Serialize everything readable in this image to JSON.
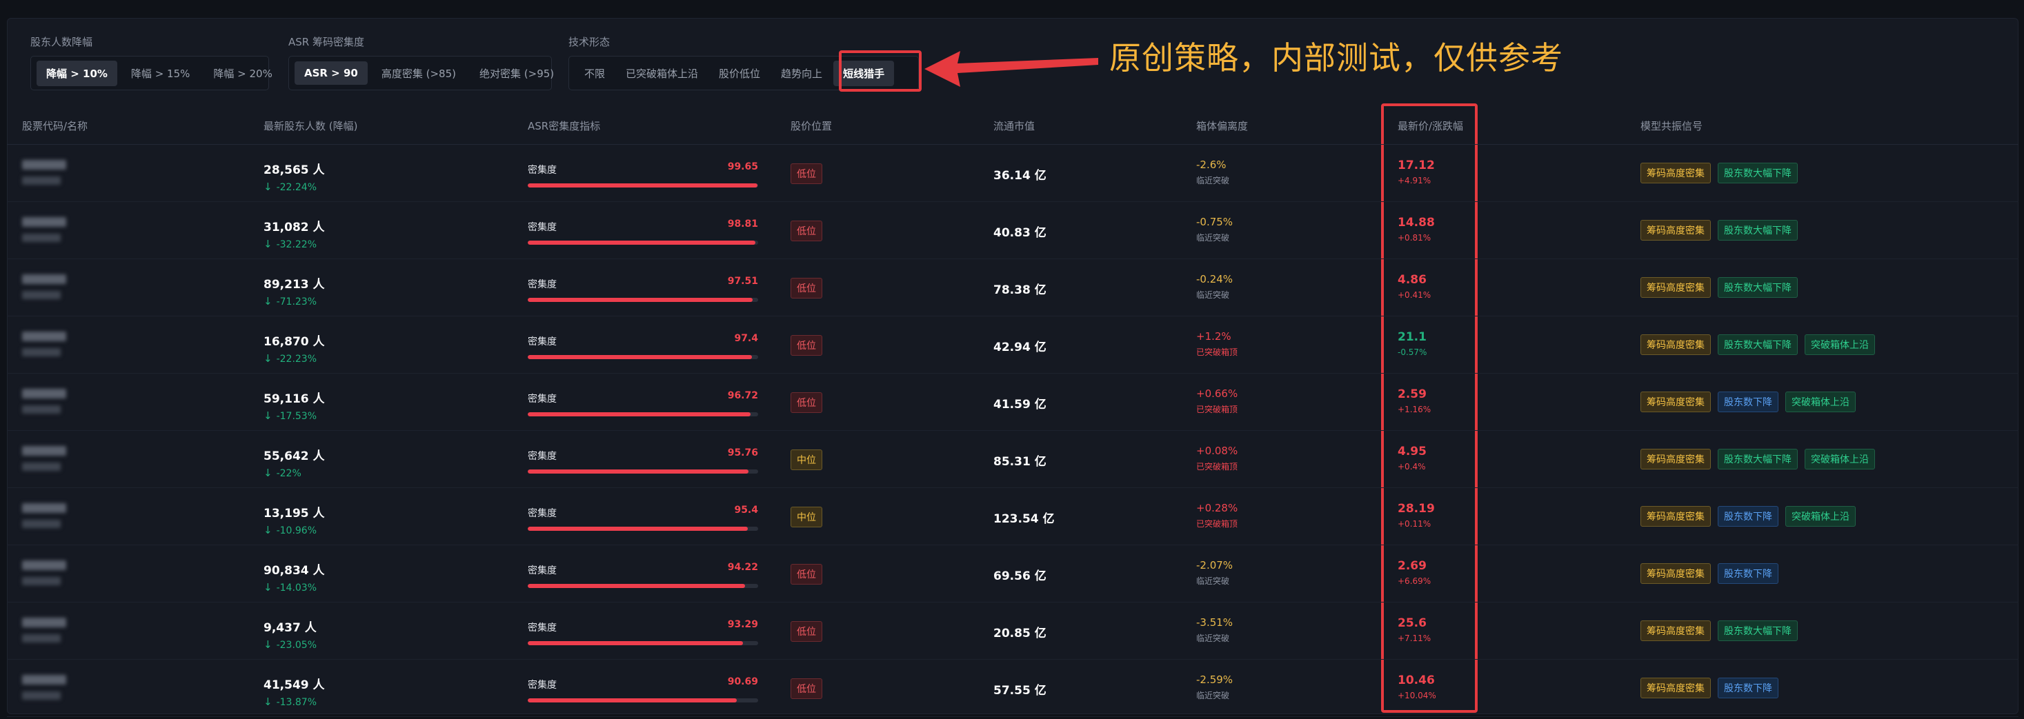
{
  "filters": {
    "holders": {
      "title": "股东人数降幅",
      "options": [
        "降幅 > 10%",
        "降幅 > 15%",
        "降幅 > 20%"
      ]
    },
    "asr": {
      "title": "ASR 筹码密集度",
      "options": [
        "ASR > 90",
        "高度密集 (>85)",
        "绝对密集 (>95)"
      ]
    },
    "tech": {
      "title": "技术形态",
      "options": [
        "不限",
        "已突破箱体上沿",
        "股价低位",
        "趋势向上",
        "短线猎手"
      ]
    }
  },
  "annotation": "原创策略，内部测试，仅供参考",
  "colors": {
    "accent_red": "#f1454f",
    "accent_green": "#22b07d",
    "annotation": "#f6b43a",
    "highlight": "#e63a3f"
  },
  "table": {
    "headers": {
      "code": "股票代码/名称",
      "holders": "最新股东人数 (降幅)",
      "asr": "ASR密集度指标",
      "position": "股价位置",
      "cap": "流通市值",
      "box": "箱体偏离度",
      "price": "最新价/涨跌幅",
      "signals": "模型共振信号"
    },
    "asr_label": "密集度",
    "rows": [
      {
        "holders": "28,565 人",
        "holders_chg": "-22.24%",
        "asr": "99.65",
        "asr_pct": 0.9965,
        "pos": "低位",
        "pos_type": "low",
        "cap": "36.14 亿",
        "box": "-2.6%",
        "box_sub": "临近突破",
        "box_type": "neg",
        "price": "17.12",
        "chg": "+4.91%",
        "dir": "up",
        "tags": [
          "筹码高度密集",
          "股东数大幅下降"
        ],
        "tag_types": [
          "y",
          "g"
        ]
      },
      {
        "holders": "31,082 人",
        "holders_chg": "-32.22%",
        "asr": "98.81",
        "asr_pct": 0.9881,
        "pos": "低位",
        "pos_type": "low",
        "cap": "40.83 亿",
        "box": "-0.75%",
        "box_sub": "临近突破",
        "box_type": "neg",
        "price": "14.88",
        "chg": "+0.81%",
        "dir": "up",
        "tags": [
          "筹码高度密集",
          "股东数大幅下降"
        ],
        "tag_types": [
          "y",
          "g"
        ]
      },
      {
        "holders": "89,213 人",
        "holders_chg": "-71.23%",
        "asr": "97.51",
        "asr_pct": 0.9751,
        "pos": "低位",
        "pos_type": "low",
        "cap": "78.38 亿",
        "box": "-0.24%",
        "box_sub": "临近突破",
        "box_type": "neg",
        "price": "4.86",
        "chg": "+0.41%",
        "dir": "up",
        "tags": [
          "筹码高度密集",
          "股东数大幅下降"
        ],
        "tag_types": [
          "y",
          "g"
        ]
      },
      {
        "holders": "16,870 人",
        "holders_chg": "-22.23%",
        "asr": "97.4",
        "asr_pct": 0.974,
        "pos": "低位",
        "pos_type": "low",
        "cap": "42.94 亿",
        "box": "+1.2%",
        "box_sub": "已突破箱顶",
        "box_type": "pos",
        "price": "21.1",
        "chg": "-0.57%",
        "dir": "down",
        "tags": [
          "筹码高度密集",
          "股东数大幅下降",
          "突破箱体上沿"
        ],
        "tag_types": [
          "y",
          "g",
          "g"
        ]
      },
      {
        "holders": "59,116 人",
        "holders_chg": "-17.53%",
        "asr": "96.72",
        "asr_pct": 0.9672,
        "pos": "低位",
        "pos_type": "low",
        "cap": "41.59 亿",
        "box": "+0.66%",
        "box_sub": "已突破箱顶",
        "box_type": "pos",
        "price": "2.59",
        "chg": "+1.16%",
        "dir": "up",
        "tags": [
          "筹码高度密集",
          "股东数下降",
          "突破箱体上沿"
        ],
        "tag_types": [
          "y",
          "b",
          "g"
        ]
      },
      {
        "holders": "55,642 人",
        "holders_chg": "-22%",
        "asr": "95.76",
        "asr_pct": 0.9576,
        "pos": "中位",
        "pos_type": "mid",
        "cap": "85.31 亿",
        "box": "+0.08%",
        "box_sub": "已突破箱顶",
        "box_type": "pos",
        "price": "4.95",
        "chg": "+0.4%",
        "dir": "up",
        "tags": [
          "筹码高度密集",
          "股东数大幅下降",
          "突破箱体上沿"
        ],
        "tag_types": [
          "y",
          "g",
          "g"
        ]
      },
      {
        "holders": "13,195 人",
        "holders_chg": "-10.96%",
        "asr": "95.4",
        "asr_pct": 0.954,
        "pos": "中位",
        "pos_type": "mid",
        "cap": "123.54 亿",
        "box": "+0.28%",
        "box_sub": "已突破箱顶",
        "box_type": "pos",
        "price": "28.19",
        "chg": "+0.11%",
        "dir": "up",
        "tags": [
          "筹码高度密集",
          "股东数下降",
          "突破箱体上沿"
        ],
        "tag_types": [
          "y",
          "b",
          "g"
        ]
      },
      {
        "holders": "90,834 人",
        "holders_chg": "-14.03%",
        "asr": "94.22",
        "asr_pct": 0.9422,
        "pos": "低位",
        "pos_type": "low",
        "cap": "69.56 亿",
        "box": "-2.07%",
        "box_sub": "临近突破",
        "box_type": "neg",
        "price": "2.69",
        "chg": "+6.69%",
        "dir": "up",
        "tags": [
          "筹码高度密集",
          "股东数下降"
        ],
        "tag_types": [
          "y",
          "b"
        ]
      },
      {
        "holders": "9,437 人",
        "holders_chg": "-23.05%",
        "asr": "93.29",
        "asr_pct": 0.9329,
        "pos": "低位",
        "pos_type": "low",
        "cap": "20.85 亿",
        "box": "-3.51%",
        "box_sub": "临近突破",
        "box_type": "neg",
        "price": "25.6",
        "chg": "+7.11%",
        "dir": "up",
        "tags": [
          "筹码高度密集",
          "股东数大幅下降"
        ],
        "tag_types": [
          "y",
          "g"
        ]
      },
      {
        "holders": "41,549 人",
        "holders_chg": "-13.87%",
        "asr": "90.69",
        "asr_pct": 0.9069,
        "pos": "低位",
        "pos_type": "low",
        "cap": "57.55 亿",
        "box": "-2.59%",
        "box_sub": "临近突破",
        "box_type": "neg",
        "price": "10.46",
        "chg": "+10.04%",
        "dir": "up",
        "tags": [
          "筹码高度密集",
          "股东数下降"
        ],
        "tag_types": [
          "y",
          "b"
        ]
      }
    ]
  }
}
